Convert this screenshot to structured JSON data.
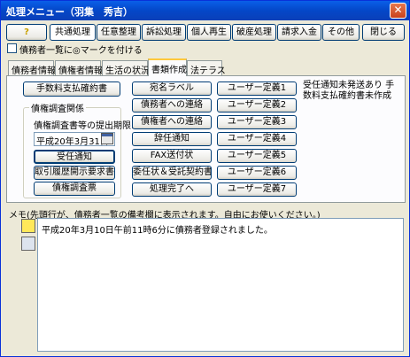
{
  "window": {
    "title": "処理メニュー（羽集　秀吉）",
    "close_glyph": "✕"
  },
  "toolbar": {
    "help_icon": "?",
    "tabs": [
      "共通処理",
      "任意整理",
      "訴訟処理",
      "個人再生",
      "破産処理",
      "請求入金",
      "その他"
    ],
    "close_label": "閉じる"
  },
  "mark_checkbox": {
    "label": "債務者一覧に◎マークを付ける",
    "checked": false
  },
  "page_tabs": [
    "債務者情報",
    "債権者情報",
    "生活の状況",
    "書類作成",
    "法テラス"
  ],
  "active_page_tab": "書類作成",
  "doc": {
    "fee_button": "手数料支払確約書",
    "group_label": "債権調査関係",
    "deadline_label": "債権調査書等の提出期限:",
    "deadline_value": "平成20年3月31日",
    "accept_notice": "受任通知",
    "disclosure_request": "取引履歴開示要求書",
    "claim_table": "債権調査票",
    "mid_buttons": [
      "宛名ラベル",
      "債務者への連絡",
      "債権者への連絡",
      "辞任通知",
      "FAX送付状",
      "委任状＆受託契約書",
      "処理完了へ"
    ],
    "user_defs": [
      "ユーザー定義1",
      "ユーザー定義2",
      "ユーザー定義3",
      "ユーザー定義4",
      "ユーザー定義5",
      "ユーザー定義6",
      "ユーザー定義7"
    ],
    "status_note": "受任通知未発送あり 手数料支払確約書未作成"
  },
  "memo": {
    "label": "メモ(先頭行が、債務者一覧の備考欄に表示されます。自由にお使いください。)",
    "text": "平成20年3月10日午前11時6分に債務者登録されました。"
  }
}
